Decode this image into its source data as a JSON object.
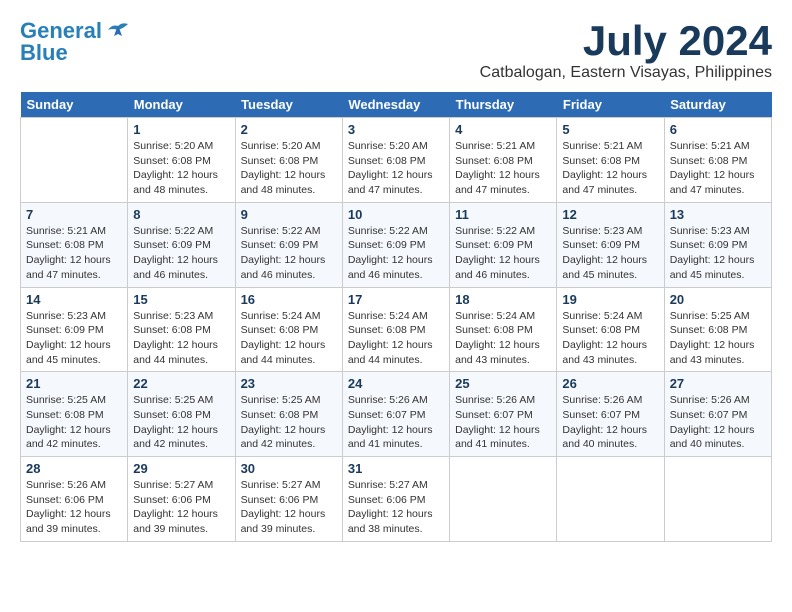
{
  "logo": {
    "line1": "General",
    "line2": "Blue"
  },
  "title": "July 2024",
  "location": "Catbalogan, Eastern Visayas, Philippines",
  "headers": [
    "Sunday",
    "Monday",
    "Tuesday",
    "Wednesday",
    "Thursday",
    "Friday",
    "Saturday"
  ],
  "weeks": [
    [
      {
        "day": "",
        "info": ""
      },
      {
        "day": "1",
        "info": "Sunrise: 5:20 AM\nSunset: 6:08 PM\nDaylight: 12 hours\nand 48 minutes."
      },
      {
        "day": "2",
        "info": "Sunrise: 5:20 AM\nSunset: 6:08 PM\nDaylight: 12 hours\nand 48 minutes."
      },
      {
        "day": "3",
        "info": "Sunrise: 5:20 AM\nSunset: 6:08 PM\nDaylight: 12 hours\nand 47 minutes."
      },
      {
        "day": "4",
        "info": "Sunrise: 5:21 AM\nSunset: 6:08 PM\nDaylight: 12 hours\nand 47 minutes."
      },
      {
        "day": "5",
        "info": "Sunrise: 5:21 AM\nSunset: 6:08 PM\nDaylight: 12 hours\nand 47 minutes."
      },
      {
        "day": "6",
        "info": "Sunrise: 5:21 AM\nSunset: 6:08 PM\nDaylight: 12 hours\nand 47 minutes."
      }
    ],
    [
      {
        "day": "7",
        "info": "Sunrise: 5:21 AM\nSunset: 6:08 PM\nDaylight: 12 hours\nand 47 minutes."
      },
      {
        "day": "8",
        "info": "Sunrise: 5:22 AM\nSunset: 6:09 PM\nDaylight: 12 hours\nand 46 minutes."
      },
      {
        "day": "9",
        "info": "Sunrise: 5:22 AM\nSunset: 6:09 PM\nDaylight: 12 hours\nand 46 minutes."
      },
      {
        "day": "10",
        "info": "Sunrise: 5:22 AM\nSunset: 6:09 PM\nDaylight: 12 hours\nand 46 minutes."
      },
      {
        "day": "11",
        "info": "Sunrise: 5:22 AM\nSunset: 6:09 PM\nDaylight: 12 hours\nand 46 minutes."
      },
      {
        "day": "12",
        "info": "Sunrise: 5:23 AM\nSunset: 6:09 PM\nDaylight: 12 hours\nand 45 minutes."
      },
      {
        "day": "13",
        "info": "Sunrise: 5:23 AM\nSunset: 6:09 PM\nDaylight: 12 hours\nand 45 minutes."
      }
    ],
    [
      {
        "day": "14",
        "info": "Sunrise: 5:23 AM\nSunset: 6:09 PM\nDaylight: 12 hours\nand 45 minutes."
      },
      {
        "day": "15",
        "info": "Sunrise: 5:23 AM\nSunset: 6:08 PM\nDaylight: 12 hours\nand 44 minutes."
      },
      {
        "day": "16",
        "info": "Sunrise: 5:24 AM\nSunset: 6:08 PM\nDaylight: 12 hours\nand 44 minutes."
      },
      {
        "day": "17",
        "info": "Sunrise: 5:24 AM\nSunset: 6:08 PM\nDaylight: 12 hours\nand 44 minutes."
      },
      {
        "day": "18",
        "info": "Sunrise: 5:24 AM\nSunset: 6:08 PM\nDaylight: 12 hours\nand 43 minutes."
      },
      {
        "day": "19",
        "info": "Sunrise: 5:24 AM\nSunset: 6:08 PM\nDaylight: 12 hours\nand 43 minutes."
      },
      {
        "day": "20",
        "info": "Sunrise: 5:25 AM\nSunset: 6:08 PM\nDaylight: 12 hours\nand 43 minutes."
      }
    ],
    [
      {
        "day": "21",
        "info": "Sunrise: 5:25 AM\nSunset: 6:08 PM\nDaylight: 12 hours\nand 42 minutes."
      },
      {
        "day": "22",
        "info": "Sunrise: 5:25 AM\nSunset: 6:08 PM\nDaylight: 12 hours\nand 42 minutes."
      },
      {
        "day": "23",
        "info": "Sunrise: 5:25 AM\nSunset: 6:08 PM\nDaylight: 12 hours\nand 42 minutes."
      },
      {
        "day": "24",
        "info": "Sunrise: 5:26 AM\nSunset: 6:07 PM\nDaylight: 12 hours\nand 41 minutes."
      },
      {
        "day": "25",
        "info": "Sunrise: 5:26 AM\nSunset: 6:07 PM\nDaylight: 12 hours\nand 41 minutes."
      },
      {
        "day": "26",
        "info": "Sunrise: 5:26 AM\nSunset: 6:07 PM\nDaylight: 12 hours\nand 40 minutes."
      },
      {
        "day": "27",
        "info": "Sunrise: 5:26 AM\nSunset: 6:07 PM\nDaylight: 12 hours\nand 40 minutes."
      }
    ],
    [
      {
        "day": "28",
        "info": "Sunrise: 5:26 AM\nSunset: 6:06 PM\nDaylight: 12 hours\nand 39 minutes."
      },
      {
        "day": "29",
        "info": "Sunrise: 5:27 AM\nSunset: 6:06 PM\nDaylight: 12 hours\nand 39 minutes."
      },
      {
        "day": "30",
        "info": "Sunrise: 5:27 AM\nSunset: 6:06 PM\nDaylight: 12 hours\nand 39 minutes."
      },
      {
        "day": "31",
        "info": "Sunrise: 5:27 AM\nSunset: 6:06 PM\nDaylight: 12 hours\nand 38 minutes."
      },
      {
        "day": "",
        "info": ""
      },
      {
        "day": "",
        "info": ""
      },
      {
        "day": "",
        "info": ""
      }
    ]
  ]
}
